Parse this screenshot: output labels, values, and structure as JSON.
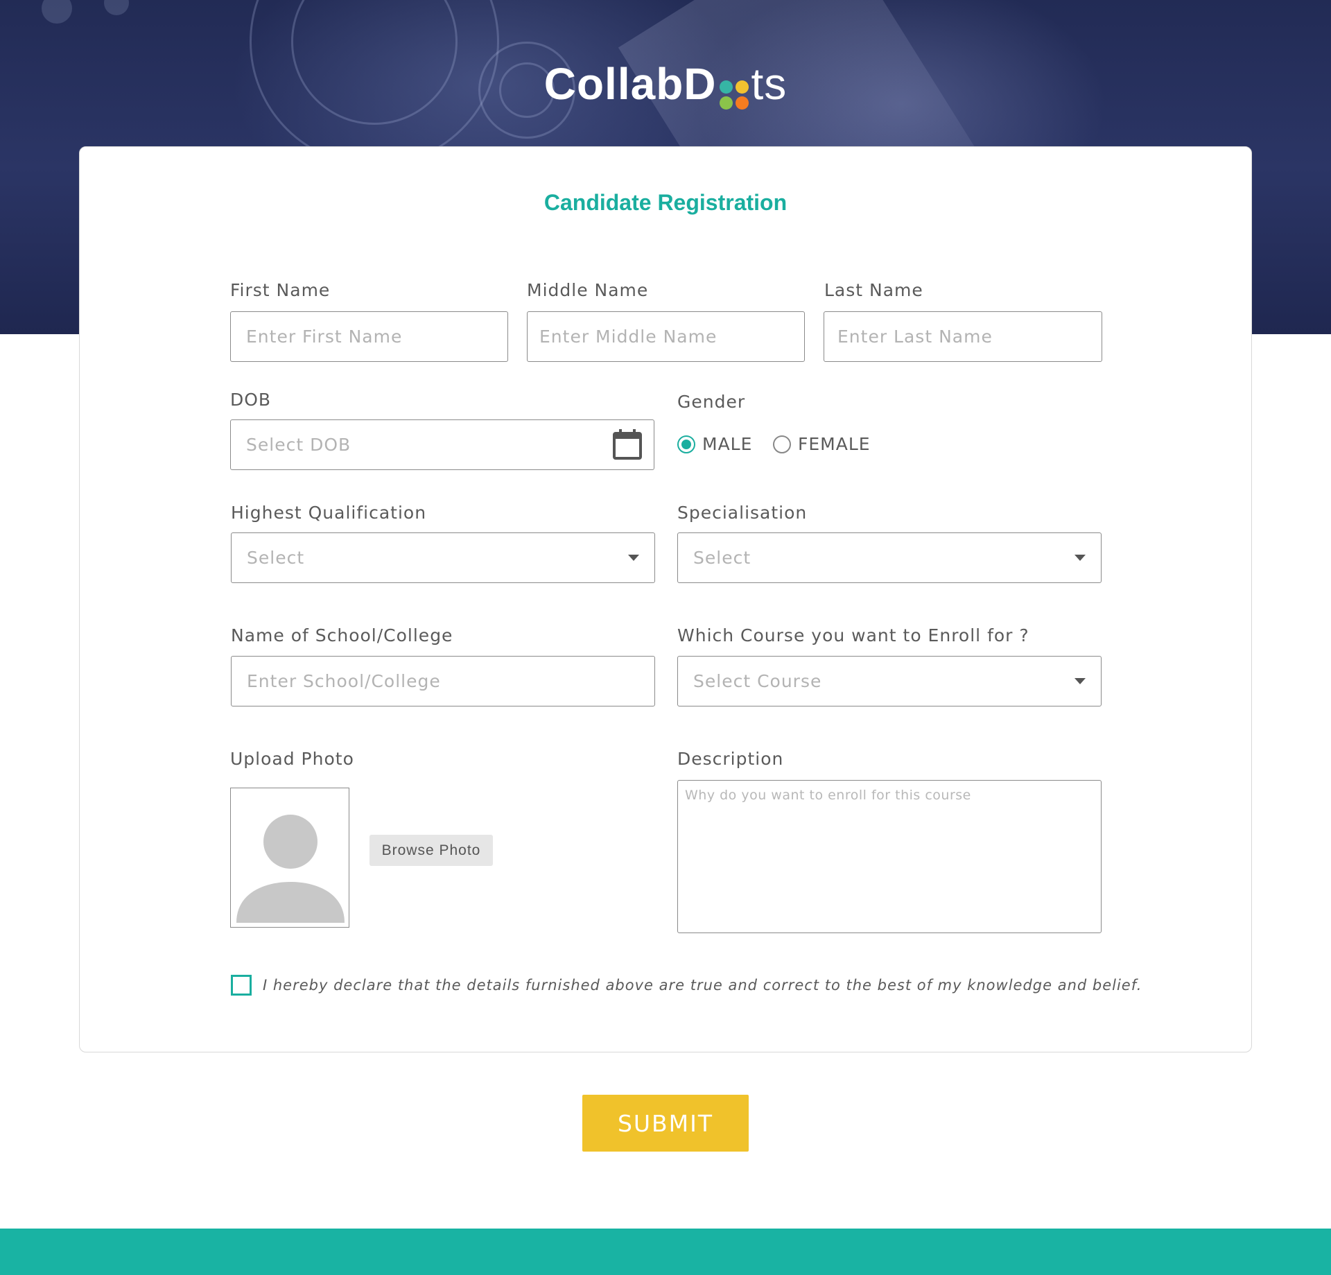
{
  "brand": {
    "logo_text_left": "CollabD",
    "logo_text_right": "ts",
    "dot_colors": [
      "#36b5a5",
      "#f2c230",
      "#8bc34a",
      "#f57c20"
    ]
  },
  "form": {
    "title": "Candidate Registration",
    "first_name": {
      "label": "First Name",
      "placeholder": "Enter First Name"
    },
    "middle_name": {
      "label": "Middle Name",
      "placeholder": "Enter Middle Name"
    },
    "last_name": {
      "label": "Last Name",
      "placeholder": "Enter Last Name"
    },
    "dob": {
      "label": "DOB",
      "placeholder": "Select DOB"
    },
    "gender": {
      "label": "Gender",
      "options": [
        "MALE",
        "FEMALE"
      ],
      "selected": "MALE"
    },
    "qualification": {
      "label": "Highest Qualification",
      "value": "Select"
    },
    "specialisation": {
      "label": "Specialisation",
      "value": "Select"
    },
    "school": {
      "label": "Name of School/College",
      "placeholder": "Enter School/College"
    },
    "course": {
      "label": "Which Course you want to Enroll for ?",
      "value": "Select Course"
    },
    "photo": {
      "label": "Upload Photo",
      "button": "Browse Photo"
    },
    "description": {
      "label": "Description",
      "placeholder": "Why do you want to enroll for this course"
    },
    "declaration": "I hereby declare that the details furnished above are true and correct to the best of my knowledge and belief."
  },
  "actions": {
    "submit": "SUBMIT"
  },
  "colors": {
    "accent": "#1aae9f",
    "submit": "#f0c22b",
    "footer": "#19b3a3",
    "hero": "#222b55"
  }
}
